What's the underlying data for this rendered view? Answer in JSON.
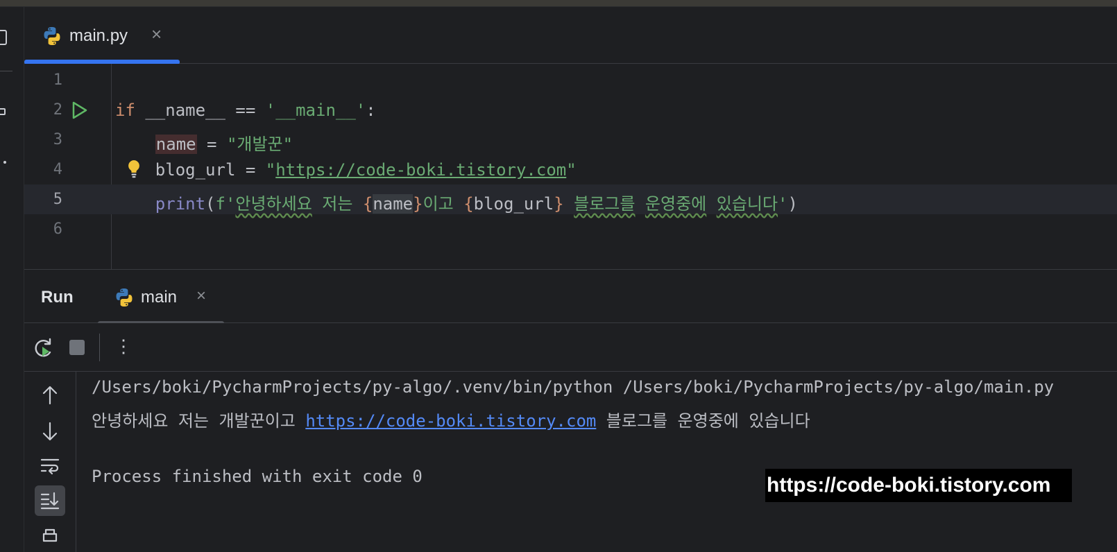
{
  "editor_tab": {
    "filename": "main.py",
    "close_symbol": "×"
  },
  "editor": {
    "line_numbers": [
      "1",
      "2",
      "3",
      "4",
      "5",
      "6"
    ],
    "line2": {
      "kw_if": "if",
      "rest": " __name__ == ",
      "str_main": "'__main__'",
      "colon": ":"
    },
    "line3": {
      "indent": "    ",
      "var": "name",
      "op": " = ",
      "str": "\"개발꾼\""
    },
    "line4": {
      "indent": "    ",
      "var": "blog_url = ",
      "q1": "\"",
      "url": "https://code-boki.tistory.com",
      "q2": "\""
    },
    "line5": {
      "indent": "    ",
      "fn": "print",
      "p1": "(",
      "fprefix": "f'",
      "ko1": "안녕하세요",
      "sp1": " 저는 ",
      "b1": "{",
      "v1": "name",
      "b2": "}",
      "ko2": "이고 ",
      "b3": "{",
      "v2": "blog_url",
      "b4": "}",
      "sp2": " ",
      "ko3": "블로그를",
      "sp3": " ",
      "ko4": "운영중에",
      "sp4": " ",
      "ko5": "있습니다",
      "q": "'",
      "p2": ")"
    }
  },
  "run_panel": {
    "label": "Run",
    "tab_title": "main",
    "close_symbol": "×",
    "more_symbol": "⋮"
  },
  "console": {
    "line1": "/Users/boki/PycharmProjects/py-algo/.venv/bin/python /Users/boki/PycharmProjects/py-algo/main.py",
    "line2_prefix": "안녕하세요 저는 개발꾼이고 ",
    "line2_link": "https://code-boki.tistory.com",
    "line2_suffix": " 블로그를 운영중에 있습니다",
    "line4": "Process finished with exit code 0"
  },
  "watermark": "https://code-boki.tistory.com",
  "colors": {
    "accent": "#3574f0",
    "keyword": "#cf8e6d",
    "string": "#6aab73",
    "function": "#8888c6",
    "link": "#548af7",
    "run_green": "#5fb865"
  },
  "icons": [
    "python-icon",
    "run-icon",
    "lightbulb-icon",
    "rerun-icon",
    "stop-icon",
    "arrow-up-icon",
    "arrow-down-icon",
    "soft-wrap-icon",
    "scroll-to-end-icon",
    "print-icon"
  ]
}
